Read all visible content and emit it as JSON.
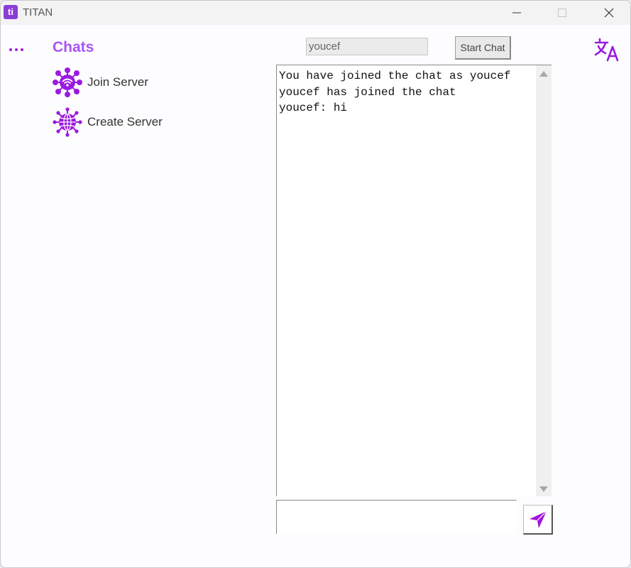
{
  "window": {
    "app_icon_text": "ti",
    "title": "TITAN"
  },
  "sidebar": {
    "title": "Chats",
    "items": [
      {
        "label": "Join Server",
        "icon": "join-server-icon"
      },
      {
        "label": "Create Server",
        "icon": "create-server-icon"
      }
    ]
  },
  "header": {
    "username_value": "youcef",
    "start_chat_label": "Start Chat",
    "translate_icon": "translate-icon"
  },
  "chat": {
    "messages_text": "You have joined the chat as youcef\nyoucef has joined the chat\nyoucef: hi"
  },
  "composer": {
    "message_value": "",
    "send_icon": "send-icon"
  },
  "colors": {
    "accent": "#a855f7",
    "icon_purple": "#9a1ae0",
    "app_icon_bg": "#8a3dd6"
  }
}
